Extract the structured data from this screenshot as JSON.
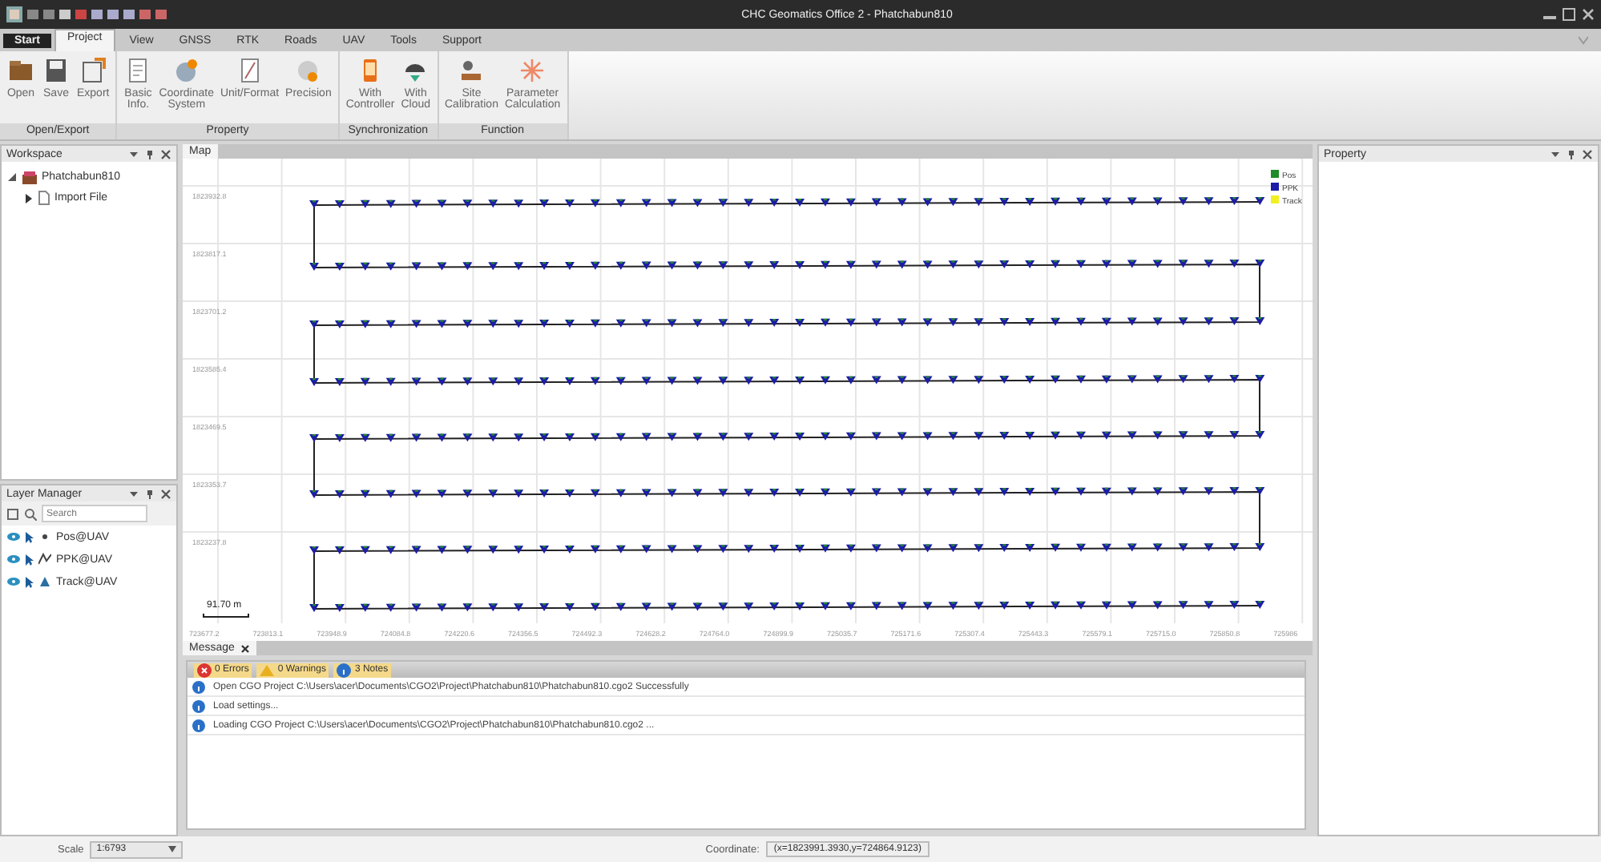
{
  "window": {
    "title": "CHC Geomatics Office 2 - Phatchabun810"
  },
  "menu_tabs": [
    {
      "label": "Start",
      "kind": "app",
      "selected": false
    },
    {
      "label": "Project",
      "kind": "tab",
      "selected": true
    },
    {
      "label": "View",
      "kind": "tab",
      "selected": false
    },
    {
      "label": "GNSS",
      "kind": "tab",
      "selected": false
    },
    {
      "label": "RTK",
      "kind": "tab",
      "selected": false
    },
    {
      "label": "Roads",
      "kind": "tab",
      "selected": false
    },
    {
      "label": "UAV",
      "kind": "tab",
      "selected": false
    },
    {
      "label": "Tools",
      "kind": "tab",
      "selected": false
    },
    {
      "label": "Support",
      "kind": "tab",
      "selected": false
    }
  ],
  "ribbon_groups": [
    {
      "label": "Open/Export",
      "buttons": [
        {
          "label": "Open",
          "disabled": false
        },
        {
          "label": "Save",
          "disabled": false
        },
        {
          "label": "Export",
          "disabled": false
        }
      ]
    },
    {
      "label": "Property",
      "buttons": [
        {
          "label": "Basic\nInfo.",
          "disabled": false
        },
        {
          "label": "Coordinate\nSystem",
          "disabled": false
        },
        {
          "label": "Unit/Format",
          "disabled": false
        },
        {
          "label": "Precision",
          "disabled": false
        }
      ]
    },
    {
      "label": "Synchronization",
      "buttons": [
        {
          "label": "With\nController",
          "disabled": false
        },
        {
          "label": "With\nCloud",
          "disabled": false
        }
      ]
    },
    {
      "label": "Function",
      "buttons": [
        {
          "label": "Site\nCalibration",
          "disabled": false
        },
        {
          "label": "Parameter\nCalculation",
          "disabled": false
        }
      ]
    }
  ],
  "workspace": {
    "title": "Workspace",
    "tree": [
      {
        "label": "Phatchabun810",
        "expanded": true,
        "children": [
          {
            "label": "Import File",
            "expanded": false
          }
        ]
      }
    ]
  },
  "layer_manager": {
    "title": "Layer Manager",
    "search": {
      "placeholder": "Search"
    },
    "layers": [
      {
        "label": "Pos@UAV"
      },
      {
        "label": "PPK@UAV"
      },
      {
        "label": "Track@UAV"
      }
    ]
  },
  "map": {
    "tab": "Map",
    "legend": [
      {
        "label": "Pos",
        "color": "#1f8a2a"
      },
      {
        "label": "PPK",
        "color": "#1c1ca8"
      },
      {
        "label": "Track",
        "color": "#f0f020"
      }
    ],
    "y_ticks": [
      "1823932.8",
      "1823817.1",
      "1823701.2",
      "1823585.4",
      "1823469.5",
      "1823353.7",
      "1823237.8"
    ],
    "x_ticks": [
      "723677.2",
      "723813.1",
      "723948.9",
      "724084.8",
      "724220.6",
      "724356.5",
      "724492.3",
      "724628.2",
      "724764.0",
      "724899.9",
      "725035.7",
      "725171.6",
      "725307.4",
      "725443.3",
      "725579.1",
      "725715.0",
      "725850.8",
      "725986"
    ],
    "scale_bar": "91.70 m"
  },
  "messages": {
    "tab": "Message",
    "filters": [
      {
        "label": "0 Errors",
        "kind": "error"
      },
      {
        "label": "0 Warnings",
        "kind": "warning"
      },
      {
        "label": "3 Notes",
        "kind": "note"
      }
    ],
    "rows": [
      "Open CGO Project C:\\Users\\acer\\Documents\\CGO2\\Project\\Phatchabun810\\Phatchabun810.cgo2 Successfully",
      "Load settings...",
      "Loading CGO Project C:\\Users\\acer\\Documents\\CGO2\\Project\\Phatchabun810\\Phatchabun810.cgo2 ..."
    ]
  },
  "property": {
    "title": "Property"
  },
  "status_bar": {
    "scale_label": "Scale",
    "scale_value": "1:6793",
    "coordinate_label": "Coordinate:",
    "coordinate_value": "(x=1823991.3930,y=724864.9123)"
  }
}
